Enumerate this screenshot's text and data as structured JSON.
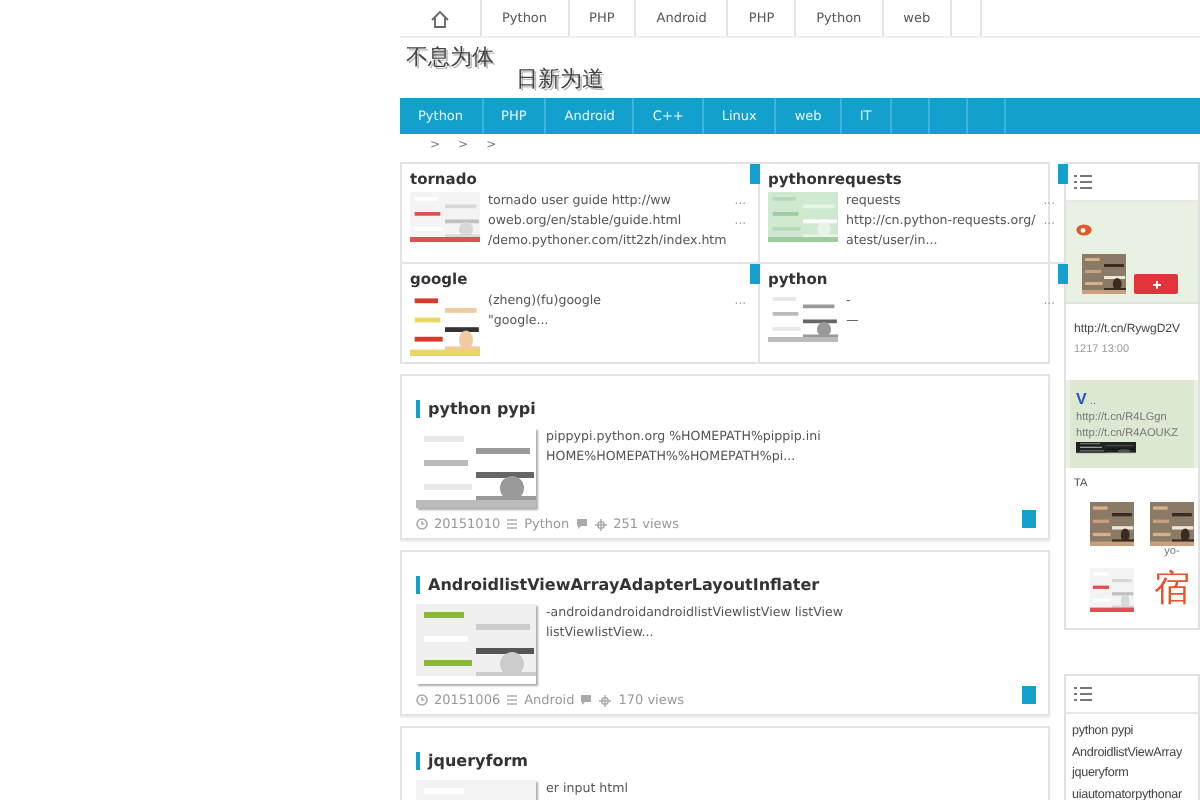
{
  "top_nav": {
    "items": [
      "Python",
      "PHP",
      "Android",
      "PHP",
      "Python",
      "web"
    ]
  },
  "logo": {
    "line_1": "不息为体",
    "line_2": "日新为道"
  },
  "main_nav": {
    "items": [
      "Python",
      "PHP",
      "Android",
      "C++",
      "Linux",
      "web",
      "IT"
    ]
  },
  "breadcrumb": [
    ">",
    ">",
    ">"
  ],
  "featured": [
    {
      "title": "tornado",
      "lines": [
        "tornado user guide http://ww",
        "oweb.org/en/stable/guide.html",
        "/demo.pythoner.com/itt2zh/index.htm"
      ],
      "dots": [
        "...",
        "..."
      ]
    },
    {
      "title": "pythonrequests",
      "lines": [
        "requests",
        "http://cn.python-requests.org/",
        "atest/user/in..."
      ],
      "dots": [
        "...",
        "..."
      ]
    },
    {
      "title": "google",
      "lines": [
        "(zheng)(fu)google",
        "\"google..."
      ],
      "dots": [
        "..."
      ]
    },
    {
      "title": "python",
      "lines": [
        "-",
        "—"
      ],
      "dots": [
        "..."
      ]
    }
  ],
  "posts": [
    {
      "title": "python pypi",
      "excerpt": "pippypi.python.org %HOMEPATH%pippip.ini HOME%HOMEPATH%%HOMEPATH%pi...",
      "date": "20151010",
      "category": "Python",
      "views": "251 views"
    },
    {
      "title": "AndroidlistViewArrayAdapterLayoutInflater",
      "excerpt": "-androidandroidandroidlistViewlistView listView listViewlistView...",
      "date": "20151006",
      "category": "Android",
      "views": "170 views"
    },
    {
      "title": "jqueryform",
      "excerpt": "er input html"
    }
  ],
  "sidebar": {
    "weibo": {
      "link": "http://t.cn/RywgD2V",
      "time": "1217 13:00",
      "repost": {
        "badge": "V",
        "dots": "..",
        "links": [
          "http://t.cn/R4LGgn",
          "http://t.cn/R4AOUKZ"
        ]
      }
    },
    "friends": {
      "title": "TA",
      "items": [
        {
          "kind": "avatar"
        },
        {
          "kind": "avatar",
          "caption": "yo-"
        },
        {
          "kind": "avatar"
        },
        {
          "kind": "logo",
          "glyph": "宿"
        }
      ]
    },
    "recent": [
      "python pypi",
      "AndroidlistViewArray",
      "jqueryform",
      "uiautomatorpythonar"
    ]
  }
}
